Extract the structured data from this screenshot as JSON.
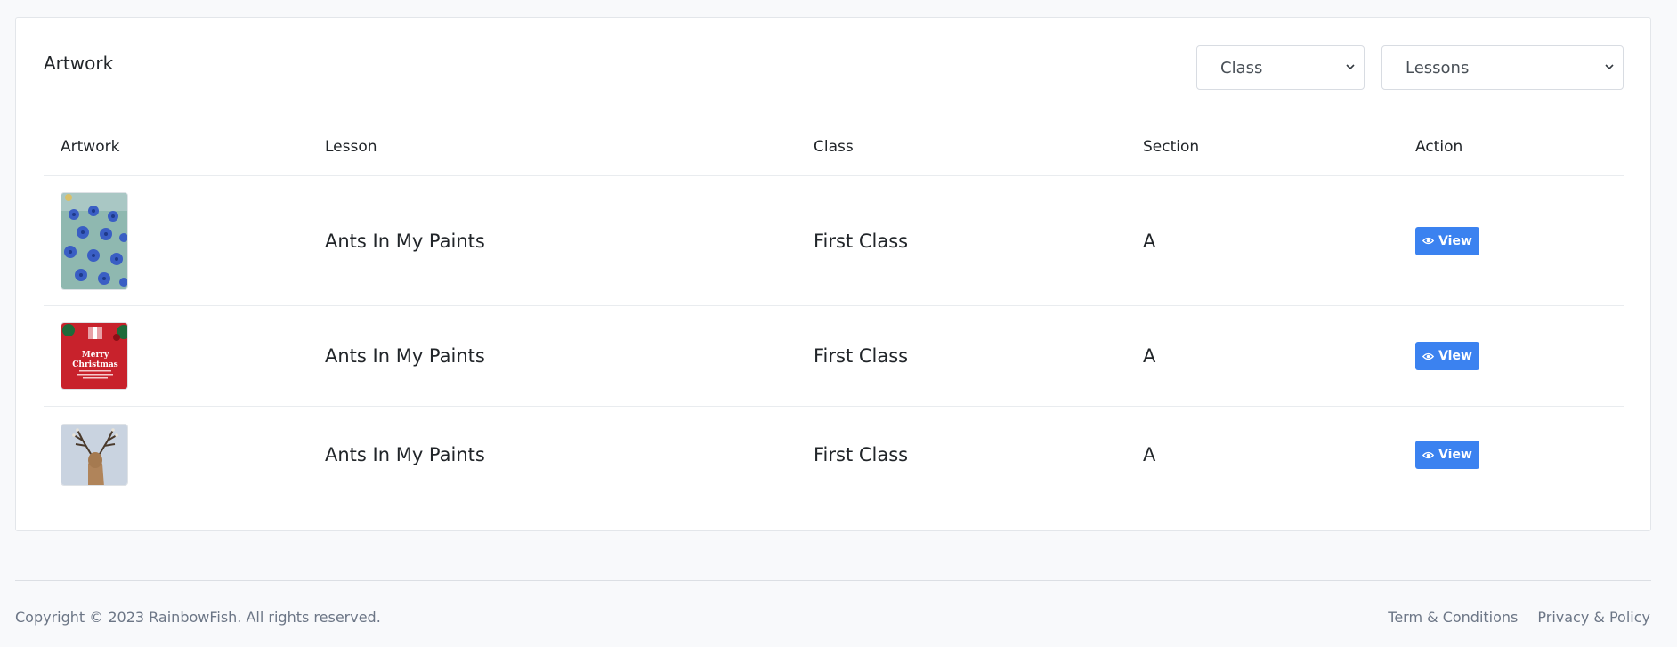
{
  "card": {
    "title": "Artwork",
    "filters": {
      "class_selected": "Class",
      "lessons_selected": "Lessons"
    }
  },
  "table": {
    "headers": [
      "Artwork",
      "Lesson",
      "Class",
      "Section",
      "Action"
    ],
    "rows": [
      {
        "artwork_icon": "blue-flowers-painting",
        "lesson": "Ants In My Paints",
        "class": "First Class",
        "section": "A",
        "action": "View"
      },
      {
        "artwork_icon": "merry-christmas-card",
        "lesson": "Ants In My Paints",
        "class": "First Class",
        "section": "A",
        "action": "View"
      },
      {
        "artwork_icon": "reindeer-painting",
        "lesson": "Ants In My Paints",
        "class": "First Class",
        "section": "A",
        "action": "View"
      }
    ]
  },
  "thumb_christmas_text": {
    "line1": "Merry",
    "line2": "Christmas"
  },
  "footer": {
    "copyright": "Copyright © 2023 RainbowFish. All rights reserved.",
    "terms": "Term & Conditions",
    "privacy": "Privacy & Policy"
  },
  "colors": {
    "accent": "#3b82f0",
    "page_bg": "#f8f9fb",
    "muted_text": "#6c7686"
  },
  "icons": {
    "select_chevron": "chevron-down-icon",
    "view_eye": "eye-icon"
  }
}
